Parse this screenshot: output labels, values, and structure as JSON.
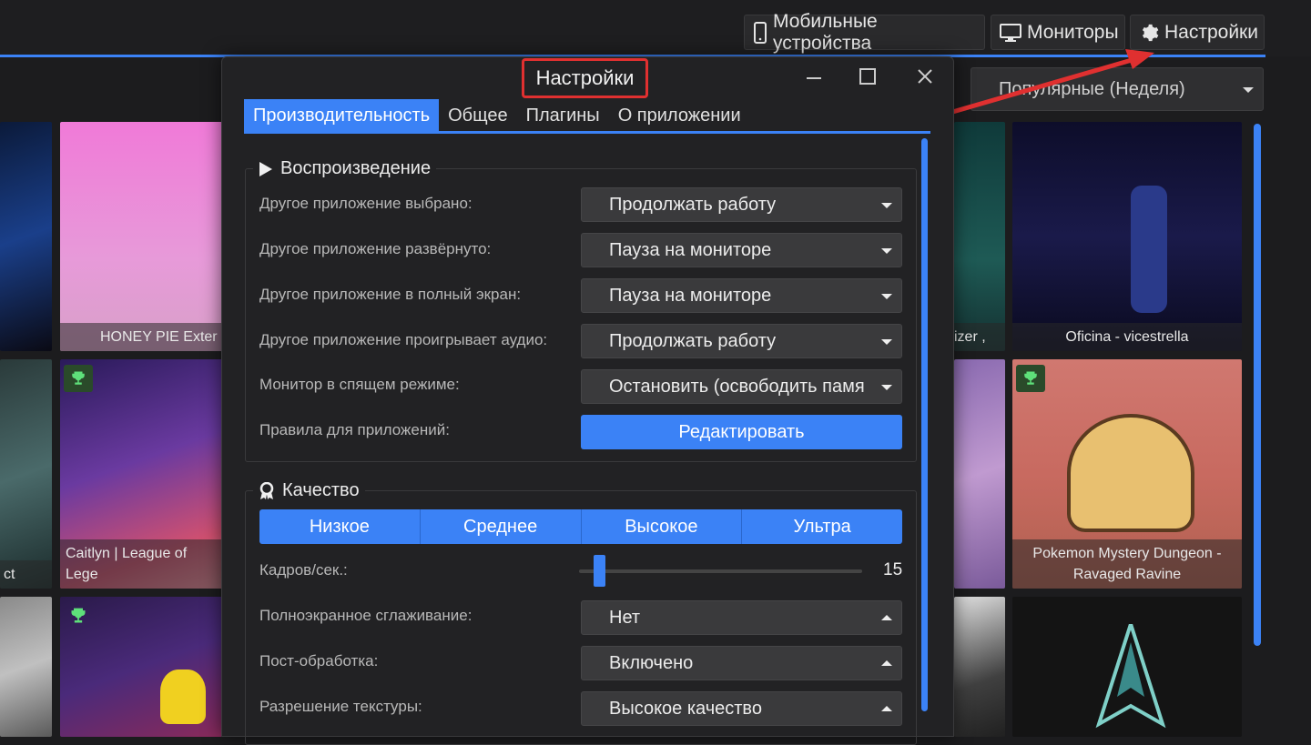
{
  "header": {
    "mobile_label": "Мобильные устройства",
    "monitors_label": "Мониторы",
    "settings_label": "Настройки"
  },
  "sort": {
    "value": "Популярные (Неделя)"
  },
  "gallery": {
    "tiles": [
      {
        "caption": "HONEY PIE Exter"
      },
      {
        "caption": "izer ,"
      },
      {
        "caption": "Oficina - vicestrella"
      },
      {
        "caption": "ct"
      },
      {
        "caption": "Caitlyn | League of Lege"
      },
      {
        "caption": "Pokemon Mystery Dungeon - Ravaged Ravine"
      }
    ]
  },
  "dialog": {
    "title": "Настройки",
    "tabs": [
      "Производительность",
      "Общее",
      "Плагины",
      "О приложении"
    ],
    "playback": {
      "title": "Воспроизведение",
      "rows": [
        {
          "label": "Другое приложение выбрано:",
          "value": "Продолжать работу"
        },
        {
          "label": "Другое приложение развёрнуто:",
          "value": "Пауза на мониторе"
        },
        {
          "label": "Другое приложение в полный экран:",
          "value": "Пауза на мониторе"
        },
        {
          "label": "Другое приложение проигрывает аудио:",
          "value": "Продолжать работу"
        },
        {
          "label": "Монитор в спящем режиме:",
          "value": "Остановить (освободить памя"
        }
      ],
      "rules_label": "Правила для приложений:",
      "edit_button": "Редактировать"
    },
    "quality": {
      "title": "Качество",
      "presets": [
        "Низкое",
        "Среднее",
        "Высокое",
        "Ультра"
      ],
      "fps_label": "Кадров/сек.:",
      "fps_value": "15",
      "fps_fraction": 0.05,
      "rows": [
        {
          "label": "Полноэкранное сглаживание:",
          "value": "Нет"
        },
        {
          "label": "Пост-обработка:",
          "value": "Включено"
        },
        {
          "label": "Разрешение текстуры:",
          "value": "Высокое качество"
        }
      ]
    }
  },
  "colors": {
    "accent": "#3b82f6",
    "highlight": "#e03030"
  }
}
